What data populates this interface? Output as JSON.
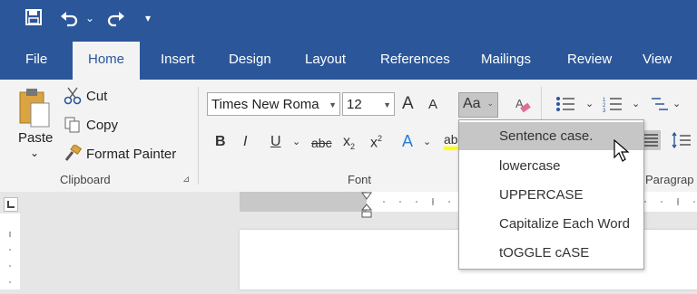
{
  "qat": {
    "undo_caret": "⌄",
    "customize": "▾"
  },
  "tabs": [
    "File",
    "Home",
    "Insert",
    "Design",
    "Layout",
    "References",
    "Mailings",
    "Review",
    "View"
  ],
  "clipboard": {
    "paste_label": "Paste",
    "paste_caret": "⌄",
    "cut_label": "Cut",
    "copy_label": "Copy",
    "format_painter_label": "Format Painter",
    "group_label": "Clipboard"
  },
  "font": {
    "font_name": "Times New Roma",
    "font_size": "12",
    "grow": "A",
    "shrink": "A",
    "change_case": "Aa",
    "bold": "B",
    "italic": "I",
    "underline": "U",
    "strikethrough": "abc",
    "subscript": "x",
    "superscript": "x",
    "text_effects": "A",
    "highlight": "ab",
    "group_label": "Font"
  },
  "paragraph": {
    "group_label": "Paragrap"
  },
  "change_case_menu": {
    "items": [
      "Sentence case.",
      "lowercase",
      "UPPERCASE",
      "Capitalize Each Word",
      "tOGGLE cASE"
    ]
  },
  "colors": {
    "brand": "#2b579a",
    "ribbon": "#f3f3f3",
    "hover": "#c6c6c6"
  }
}
